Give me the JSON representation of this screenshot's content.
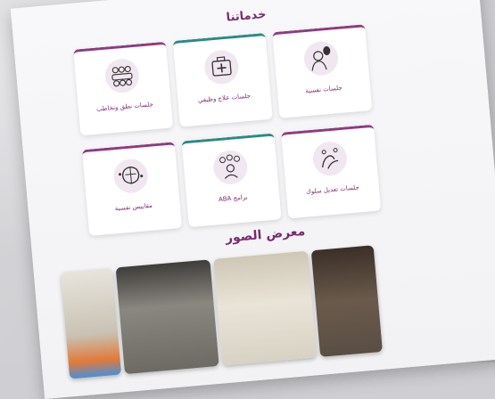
{
  "services": {
    "title": "خدماتنا",
    "cards": [
      {
        "label": "جلسات نفسية",
        "icon": "psychology-session-icon",
        "accent": "#8f3a82"
      },
      {
        "label": "جلسات علاج وظيفي",
        "icon": "first-aid-kit-icon",
        "accent": "#2a8a86"
      },
      {
        "label": "جلسات نطق وتخاطب",
        "icon": "group-meeting-icon",
        "accent": "#8f3a82"
      },
      {
        "label": "جلسات تعديل سلوك",
        "icon": "behavior-hands-icon",
        "accent": "#8f3a82"
      },
      {
        "label": "برامج ABA",
        "icon": "person-network-icon",
        "accent": "#2a8a86"
      },
      {
        "label": "مقاييس نفسية",
        "icon": "brain-circuit-icon",
        "accent": "#8f3a82"
      }
    ]
  },
  "gallery": {
    "title": "معرض الصور",
    "photos": [
      {
        "caption": "",
        "tone": "#c9c2b4"
      },
      {
        "caption": "",
        "tone": "#6d6a64"
      },
      {
        "caption": "",
        "tone": "#d8d2c4"
      },
      {
        "caption": "",
        "tone": "#5a4e44"
      }
    ]
  },
  "colors": {
    "brand": "#7a2a6e",
    "teal": "#2a8a86",
    "whatsapp": "#2bb24c"
  }
}
